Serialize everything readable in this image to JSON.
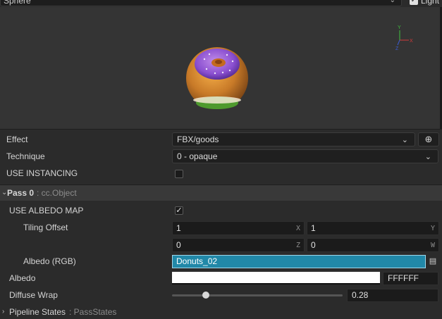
{
  "header": {
    "mesh_value": "Sphere",
    "light_label": "Light",
    "light_checked": true
  },
  "preview": {
    "axis_labels": {
      "x": "X",
      "y": "Y",
      "z": "Z"
    }
  },
  "properties": {
    "effect": {
      "label": "Effect",
      "value": "FBX/goods"
    },
    "technique": {
      "label": "Technique",
      "value": "0 - opaque"
    },
    "use_instancing": {
      "label": "USE INSTANCING",
      "checked": false
    }
  },
  "pass": {
    "title": "Pass 0",
    "type_label": ": cc.Object",
    "use_albedo_map": {
      "label": "USE ALBEDO MAP",
      "checked": true
    },
    "tiling_offset": {
      "label": "Tiling Offset",
      "x": "1",
      "y": "1",
      "z": "0",
      "w": "0",
      "axis": {
        "x": "X",
        "y": "Y",
        "z": "Z",
        "w": "W"
      }
    },
    "albedo_rgb": {
      "label": "Albedo (RGB)",
      "value": "Donuts_02"
    },
    "albedo": {
      "label": "Albedo",
      "hex": "FFFFFF",
      "color": "#ffffff"
    },
    "diffuse_wrap": {
      "label": "Diffuse Wrap",
      "value_text": "0.28",
      "fraction": 0.2
    }
  },
  "pipeline": {
    "title": "Pipeline States",
    "type_label": ": PassStates"
  },
  "icons": {
    "dropdown": "chevron-down-icon",
    "target": "locate-target-icon",
    "check": "checkmark-icon",
    "fold_open": "chevron-down-small-icon",
    "fold_closed": "chevron-right-icon",
    "asset": "asset-locate-icon"
  }
}
